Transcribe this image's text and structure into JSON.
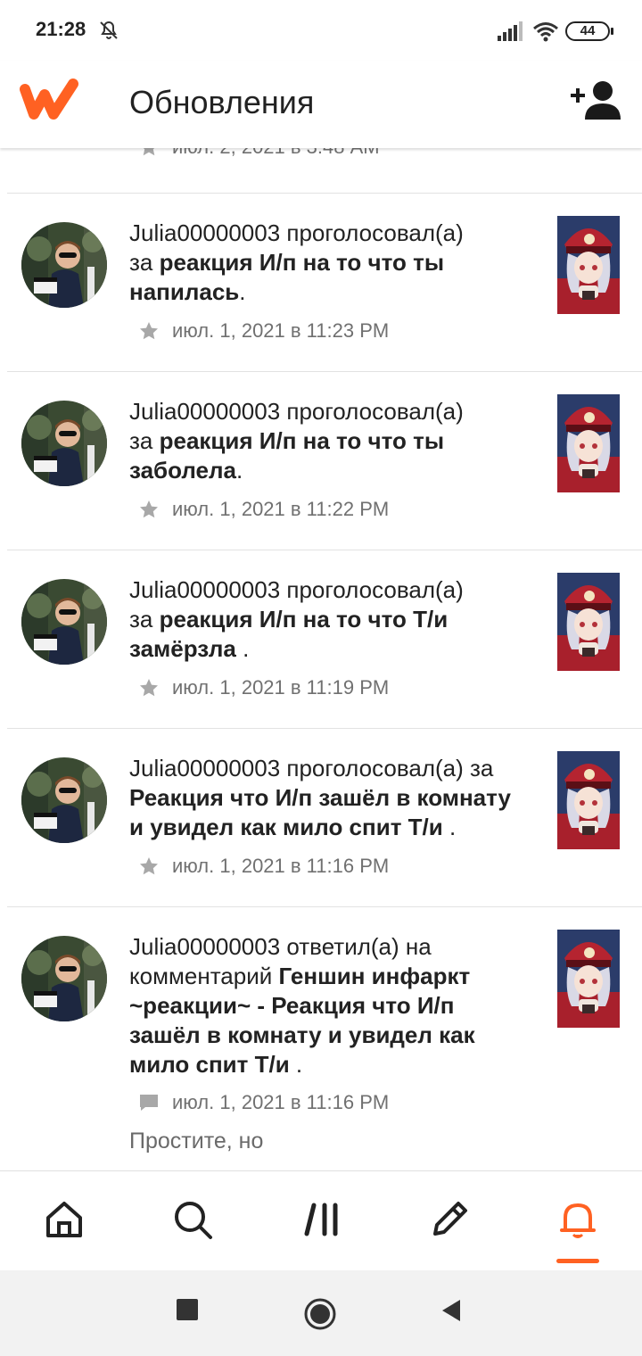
{
  "status": {
    "time": "21:28",
    "battery": "44"
  },
  "header": {
    "title": "Обновления"
  },
  "colors": {
    "accent": "#ff6122",
    "text": "#222222",
    "meta": "#707070"
  },
  "feed": {
    "partial_timestamp": "июл. 2, 2021 в 3:48 AM",
    "items": [
      {
        "user": "Julia00000003",
        "action": " проголосовал(а) ",
        "line1_suffix": "",
        "line2_prefix": "за ",
        "story": "реакция И/п на то что ты",
        "story_line3": "напилась",
        "tail": ".",
        "timestamp": "июл. 1, 2021 в 11:23 PM",
        "icon": "star-icon"
      },
      {
        "user": "Julia00000003",
        "action": " проголосовал(а) ",
        "line1_suffix": "",
        "line2_prefix": "за ",
        "story": "реакция И/п на то что ты",
        "story_line3": "заболела",
        "tail": ".",
        "timestamp": "июл. 1, 2021 в 11:22 PM",
        "icon": "star-icon"
      },
      {
        "user": "Julia00000003",
        "action": " проголосовал(а) ",
        "line1_suffix": "",
        "line2_prefix": "за ",
        "story": "реакция И/п на то что Т/и",
        "story_line3": "замёрзла",
        "tail": " .",
        "timestamp": "июл. 1, 2021 в 11:19 PM",
        "icon": "star-icon"
      },
      {
        "user": "Julia00000003",
        "action": " проголосовал(а) за",
        "line1_suffix": "",
        "line2_prefix": "",
        "story": "Реакция что И/п зашёл в комнату",
        "story_line3": "и увидел как мило спит Т/и",
        "tail": " .",
        "timestamp": "июл. 1, 2021 в 11:16 PM",
        "icon": "star-icon"
      },
      {
        "user": "Julia00000003",
        "action": " ответил(а) на",
        "line2_prefix": "комментарий ",
        "line2_bold": "Геншин инфаркт",
        "line3": "~реакции~ - Реакция что И/п",
        "line4": "зашёл в комнату и увидел как",
        "line5": "мило спит Т/и",
        "tail": " .",
        "timestamp": "июл. 1, 2021 в 11:16 PM",
        "icon": "comment-icon",
        "snippet": "Простите, но"
      }
    ]
  }
}
